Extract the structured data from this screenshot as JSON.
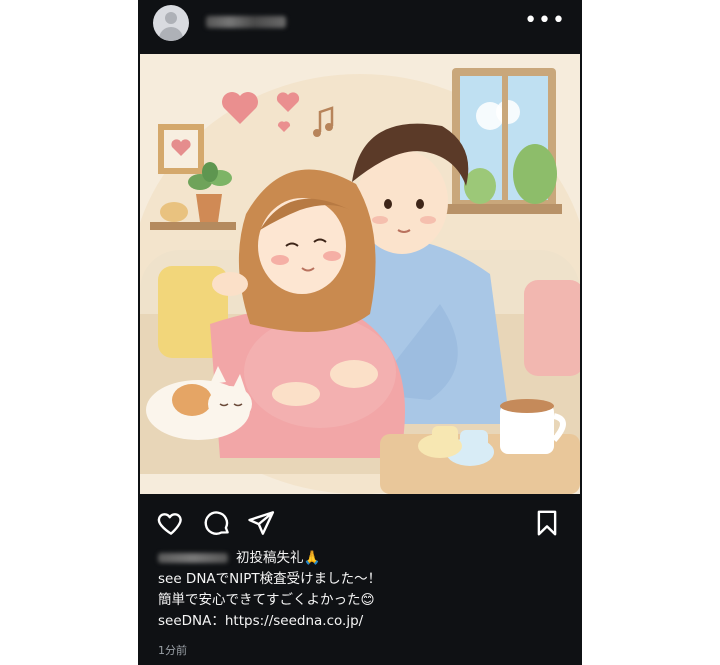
{
  "post": {
    "caption_line1": "初投稿失礼🙏",
    "caption_line2": "see DNAでNIPT検査受けました〜！",
    "caption_line3": "簡単で安心できてすごくよかった😊",
    "caption_line4": "seeDNA：https://seedna.co.jp/",
    "timestamp": "1分前"
  },
  "icons": {
    "avatar": "default-avatar-icon",
    "more": "more-options-icon",
    "like": "heart-icon",
    "comment": "comment-icon",
    "share": "share-icon",
    "save": "bookmark-icon"
  },
  "colors": {
    "background": "#0f1114",
    "text": "#f5f5f5",
    "muted": "#9aa0a6"
  }
}
